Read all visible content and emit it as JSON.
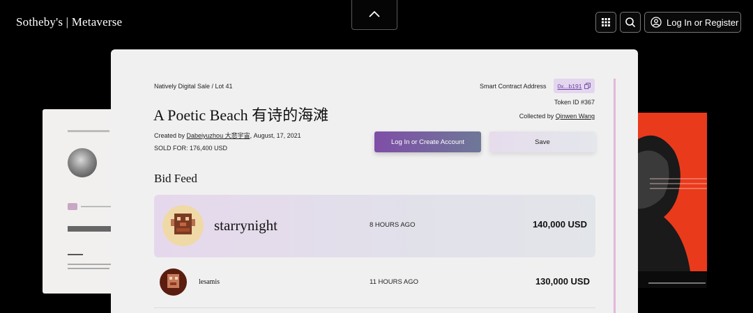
{
  "header": {
    "brand": "Sotheby's | Metaverse",
    "login_label": "Log In or Register"
  },
  "icons": {
    "collapse": "chevron-up-icon",
    "apps": "grid-icon",
    "search": "search-icon",
    "user": "user-circle-icon",
    "copy": "copy-icon"
  },
  "lot": {
    "breadcrumb": "Natively Digital Sale / Lot 41",
    "title": "A Poetic Beach 有诗的海滩",
    "created_prefix": "Created by ",
    "creator": "Dabeiyuzhou 大悲宇宙",
    "created_date": ", August, 17, 2021",
    "sold": "SOLD FOR: 176,400 USD"
  },
  "contract": {
    "label": "Smart Contract Address",
    "address": "0x...b191",
    "token": "Token ID #367",
    "collected_prefix": "Collected by ",
    "collector": "Qinwen Wang"
  },
  "actions": {
    "create_account": "Log In or Create Account",
    "save": "Save"
  },
  "bid_feed": {
    "title": "Bid Feed",
    "bids": [
      {
        "name": "starrynight",
        "time": "8 HOURS AGO",
        "amount": "140,000 USD"
      },
      {
        "name": "lesamis",
        "time": "11 HOURS AGO",
        "amount": "130,000 USD"
      }
    ]
  },
  "colors": {
    "accent_purple": "#7f4ea7",
    "scroll_track": "#e4b6dc",
    "bg_right_art": "#ea3a1c"
  }
}
